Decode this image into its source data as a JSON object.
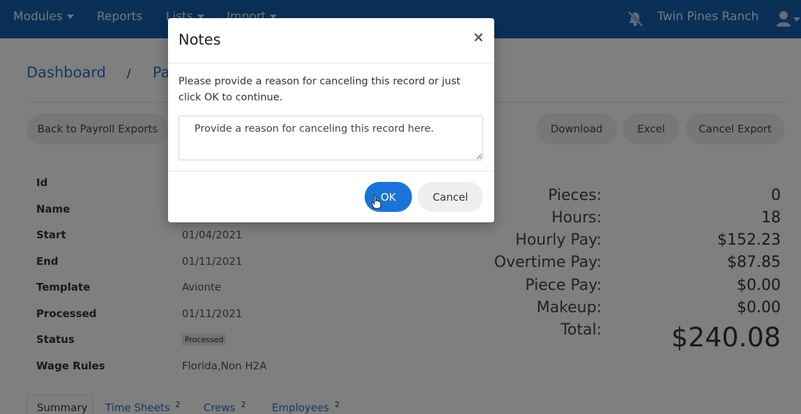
{
  "nav": {
    "modules": "Modules",
    "reports": "Reports",
    "lists": "Lists",
    "import": "Import",
    "ranch": "Twin Pines Ranch",
    "bell_icon": "bell-slash-icon",
    "user_icon": "user-icon"
  },
  "breadcrumb": {
    "dashboard": "Dashboard",
    "sep": "/",
    "current": "Pa"
  },
  "actions": {
    "back": "Back to Payroll Exports",
    "download": "Download",
    "excel": "Excel",
    "cancel_export": "Cancel Export"
  },
  "details": [
    {
      "label": "Id",
      "value": ""
    },
    {
      "label": "Name",
      "value": ""
    },
    {
      "label": "Start",
      "value": "01/04/2021"
    },
    {
      "label": "End",
      "value": "01/11/2021"
    },
    {
      "label": "Template",
      "value": "Avionte"
    },
    {
      "label": "Processed",
      "value": "01/11/2021"
    },
    {
      "label": "Status",
      "value": "Processed"
    },
    {
      "label": "Wage Rules",
      "value": "Florida,Non H2A"
    }
  ],
  "totals": [
    {
      "label": "Pieces:",
      "value": "0"
    },
    {
      "label": "Hours:",
      "value": "18"
    },
    {
      "label": "Hourly Pay:",
      "value": "$152.23"
    },
    {
      "label": "Overtime Pay:",
      "value": "$87.85"
    },
    {
      "label": "Piece Pay:",
      "value": "$0.00"
    },
    {
      "label": "Makeup:",
      "value": "$0.00"
    },
    {
      "label": "Total:",
      "value": "$240.08"
    }
  ],
  "tabs": [
    {
      "label": "Summary",
      "count": ""
    },
    {
      "label": "Time Sheets",
      "count": "2"
    },
    {
      "label": "Crews",
      "count": "2"
    },
    {
      "label": "Employees",
      "count": "2"
    }
  ],
  "modal": {
    "title": "Notes",
    "close": "×",
    "message": "Please provide a reason for canceling this record or just click OK to continue.",
    "textarea_value": "Provide a reason for canceling this record here.",
    "ok": "OK",
    "cancel": "Cancel"
  },
  "colors": {
    "navbar": "#1560b0",
    "link": "#2a72c0",
    "primary_button": "#1a73d9"
  }
}
